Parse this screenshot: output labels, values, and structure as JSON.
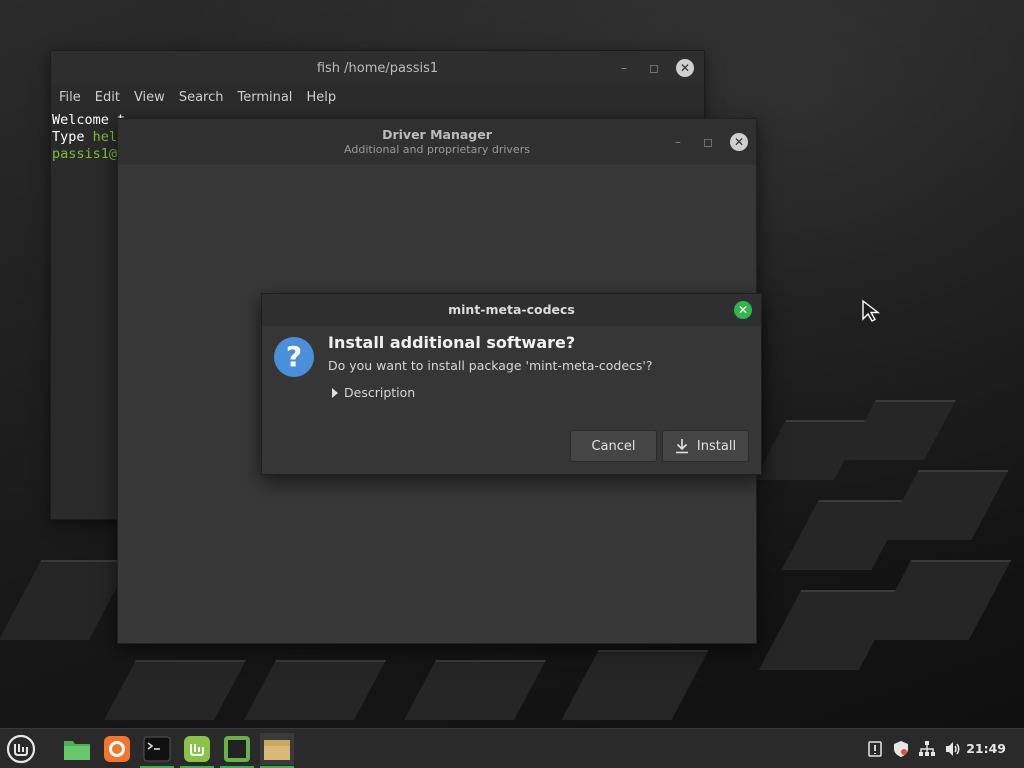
{
  "terminal": {
    "title": "fish /home/passis1",
    "menu": [
      "File",
      "Edit",
      "View",
      "Search",
      "Terminal",
      "Help"
    ],
    "line1": "Welcome t",
    "line2_prefix": "Type ",
    "line2_hl": "hel",
    "line3": "passis1@"
  },
  "driver_manager": {
    "title": "Driver Manager",
    "subtitle": "Additional and proprietary drivers"
  },
  "dialog": {
    "title": "mint-meta-codecs",
    "heading": "Install additional software?",
    "text": "Do you want to install package 'mint-meta-codecs'?",
    "expander_label": "Description",
    "cancel_label": "Cancel",
    "install_label": "Install"
  },
  "taskbar": {
    "clock": "21:49"
  },
  "colors": {
    "accent": "#35b552",
    "question_icon": "#4a90d9"
  }
}
